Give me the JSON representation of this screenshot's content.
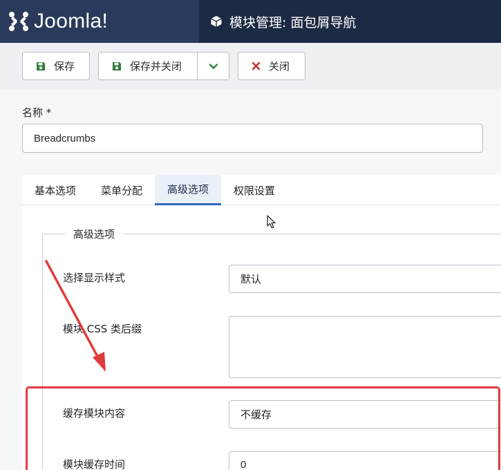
{
  "header": {
    "brand": "Joomla!",
    "title": "模块管理: 面包屑导航"
  },
  "toolbar": {
    "save_label": "保存",
    "save_close_label": "保存并关闭",
    "close_label": "关闭"
  },
  "form": {
    "name_label": "名称 *",
    "name_value": "Breadcrumbs"
  },
  "tabs": [
    {
      "label": "基本选项"
    },
    {
      "label": "菜单分配"
    },
    {
      "label": "高级选项",
      "active": true
    },
    {
      "label": "权限设置"
    }
  ],
  "advanced": {
    "legend": "高级选项",
    "layout_label": "选择显示样式",
    "layout_value": "默认",
    "css_label": "模块 CSS 类后缀",
    "css_value": "",
    "cache_label": "缓存模块内容",
    "cache_value": "不缓存",
    "cache_time_label": "模块缓存时间",
    "cache_time_value": "0"
  },
  "colors": {
    "brand_bg": "#2a3a5c",
    "title_bg": "#1c2a43",
    "save_icon": "#2e7d3b",
    "close_icon": "#c9302c",
    "active_tab_border": "#2f6ab5",
    "annotation": "#e03c3c"
  },
  "icons": [
    "joomla-logo-icon",
    "cube-icon",
    "floppy-disk-icon",
    "chevron-down-icon",
    "close-x-icon",
    "mouse-cursor-icon"
  ]
}
